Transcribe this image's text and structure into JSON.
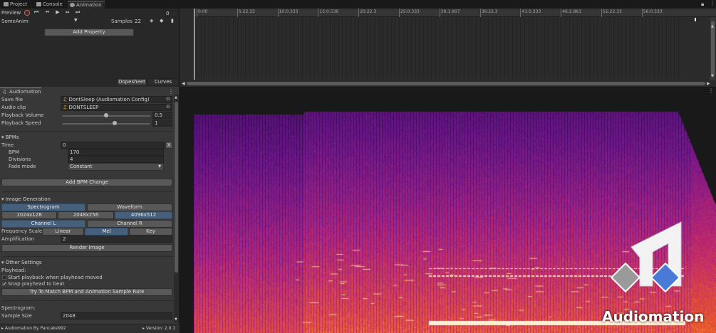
{
  "tabs": [
    {
      "label": "Project",
      "icon": "folder-icon"
    },
    {
      "label": "Console",
      "icon": "console-icon"
    },
    {
      "label": "Animation",
      "icon": "animation-icon"
    }
  ],
  "animation": {
    "preview_label": "Preview",
    "frame_value": "0",
    "clip_name": "SomeAnim",
    "samples_label": "Samples",
    "samples_value": "22",
    "add_property_label": "Add Property",
    "dopesheet_label": "Dopesheet",
    "curves_label": "Curves",
    "ruler_ticks": [
      "0:00",
      "5:22.33",
      "10:0.333",
      "15:0.536",
      "20:22.3",
      "25:0.333",
      "30:1.907",
      "36:22.3",
      "41:0.333",
      "46:2.861",
      "51:22.33",
      "56:0.333"
    ]
  },
  "audiomation": {
    "tab_label": "Audiomation",
    "save_file_label": "Save file",
    "save_file_value": "DontSleep (Audiomation Config)",
    "audio_clip_label": "Audio clip",
    "audio_clip_value": "DONTSLEEP",
    "playback_volume_label": "Playback Volume",
    "playback_volume_value": "0.5",
    "playback_volume_fraction": 0.5,
    "playback_speed_label": "Playback Speed",
    "playback_speed_value": "1",
    "playback_speed_fraction": 0.6,
    "bpms_section": "BPMs",
    "time_label": "Time",
    "time_value": "0",
    "time_clear": "X",
    "bpm_label": "BPM",
    "bpm_value": "170",
    "divisions_label": "Divisions",
    "divisions_value": "4",
    "fade_mode_label": "Fade mode",
    "fade_mode_value": "Constant",
    "add_bpm_change_label": "Add BPM Change",
    "image_gen_section": "Image Generation",
    "spectrogram_label": "Spectrogram",
    "waveform_label": "Waveform",
    "res_1": "1024x128",
    "res_2": "2048x256",
    "res_3": "4096x512",
    "channel_l_label": "Channel L",
    "channel_r_label": "Channel R",
    "freq_scale_label": "Frequency Scale",
    "linear_label": "Linear",
    "mel_label": "Mel",
    "key_label": "Key",
    "amplification_label": "Amplification",
    "amplification_value": "2",
    "render_image_label": "Render Image",
    "other_settings_section": "Other Settings",
    "playhead_label": "Playhead:",
    "start_playback_label": "Start playback when playhead moved",
    "snap_playhead_label": "Snap playhead to beat",
    "snap_check": "✔",
    "match_bpm_label": "Try To Match BPM and Animation Sample Rate",
    "spectrogram_subsection": "Spectrogram:",
    "sample_size_label": "Sample Size",
    "sample_size_value": "2048",
    "footer_left": "Audiomation By Pancake992",
    "footer_right": "Version: 2.0.1"
  },
  "logo": {
    "text": "Audiomation",
    "icon": "audiomation-logo-icon"
  },
  "colors": {
    "accent_blue": "#4a7ad8",
    "selected_button": "#46607c",
    "spectrogram_low": "#3b0a5a",
    "spectrogram_high": "#fff6c0"
  }
}
